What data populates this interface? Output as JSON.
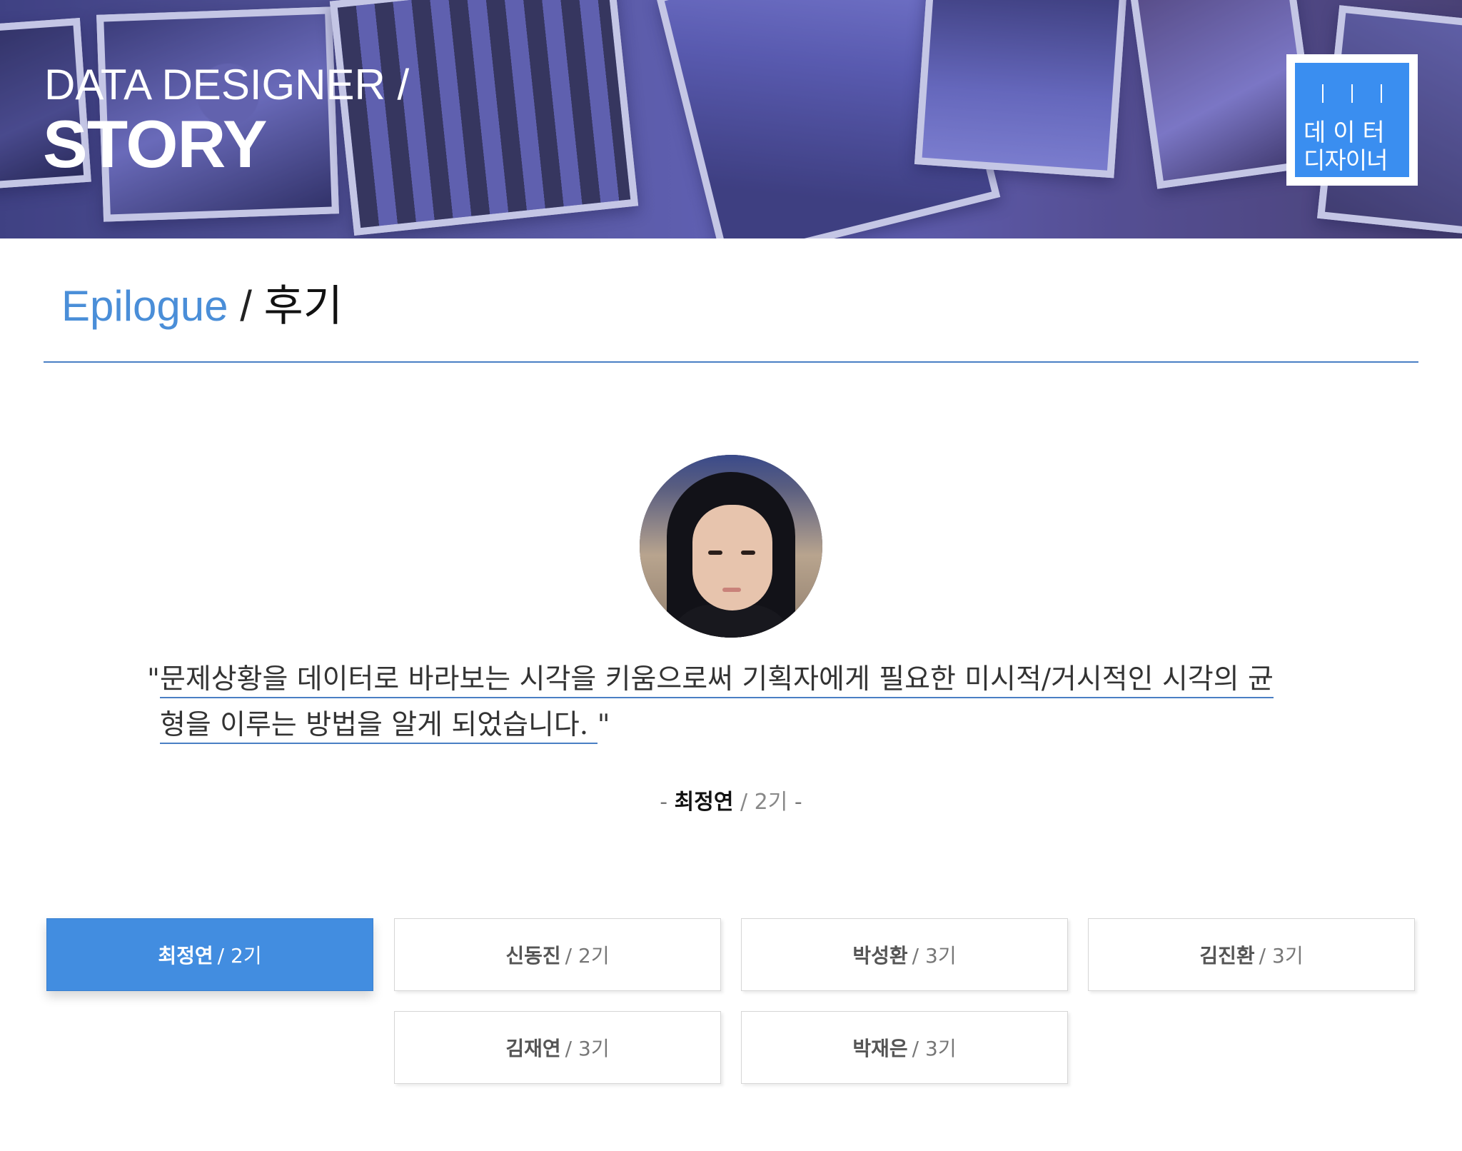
{
  "hero": {
    "title_small": "DATA DESIGNER /",
    "title_big": "STORY",
    "logo": {
      "line1": "데이터",
      "line2": "디자이너",
      "color": "#3a8ef0"
    }
  },
  "section": {
    "title_en": "Epilogue",
    "separator": " / ",
    "title_ko": "후기"
  },
  "testimonial": {
    "quote_open": "\"",
    "quote_line1": "문제상황을 데이터로 바라보는 시각을 키움으로써 기획자에게 필요한 미시적/거시적인 시각의 균",
    "quote_line2": "형을 이루는 방법을 알게 되었습니다. ",
    "quote_close": "\"",
    "author_prefix": "- ",
    "author_name": "최정연",
    "author_gen": " / 2기",
    "author_suffix": " -"
  },
  "people": [
    {
      "name": "최정연",
      "gen": "/ 2기",
      "active": true
    },
    {
      "name": "신동진",
      "gen": "/ 2기",
      "active": false
    },
    {
      "name": "박성환",
      "gen": "/ 3기",
      "active": false
    },
    {
      "name": "김진환",
      "gen": "/ 3기",
      "active": false
    },
    {
      "name": "김재연",
      "gen": "/ 3기",
      "active": false
    },
    {
      "name": "박재은",
      "gen": "/ 3기",
      "active": false
    }
  ],
  "colors": {
    "accent": "#428de0",
    "divider": "#4a7fc4",
    "heading_en": "#4a8ed8"
  }
}
